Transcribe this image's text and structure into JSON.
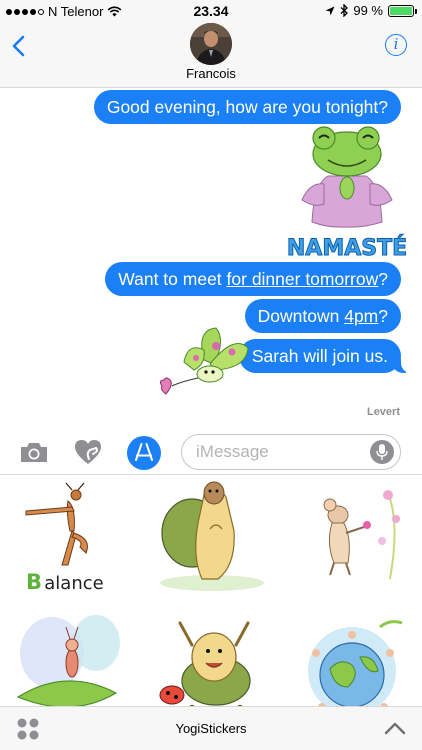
{
  "status_bar": {
    "carrier": "N Telenor",
    "time": "23.34",
    "battery_percent": "99 %",
    "battery_level": 0.99,
    "signal_bars_filled": 4,
    "signal_bars_total": 5
  },
  "header": {
    "contact_name": "Francois",
    "info_label": "i"
  },
  "messages": [
    {
      "type": "text",
      "text": "Good evening, how are you tonight?"
    },
    {
      "type": "sticker",
      "sticker_text": "NAMASTÉ",
      "icon": "frog-namaste-sticker"
    },
    {
      "type": "text",
      "parts": [
        "Want to meet ",
        "for dinner tomorrow",
        "?"
      ]
    },
    {
      "type": "text",
      "parts": [
        "Downtown ",
        "4pm",
        "?"
      ]
    },
    {
      "type": "text",
      "text": "Sarah will join us."
    },
    {
      "type": "sticker",
      "icon": "butterfly-heart-sticker"
    }
  ],
  "delivery_status": "Levert",
  "input_bar": {
    "placeholder": "iMessage",
    "value": "",
    "icons": [
      "camera-icon",
      "digital-touch-heart-icon",
      "app-store-icon",
      "microphone-icon"
    ]
  },
  "drawer": {
    "stickers": [
      {
        "name": "ant-balance-sticker",
        "caption": "Balance"
      },
      {
        "name": "turtle-yoga-sticker"
      },
      {
        "name": "mouse-flowers-sticker"
      },
      {
        "name": "fairy-leaf-sticker"
      },
      {
        "name": "turtle-ladybug-sticker"
      },
      {
        "name": "earth-yogis-sticker"
      }
    ]
  },
  "bottom_bar": {
    "app_name": "YogiStickers",
    "icons": [
      "app-drawer-grid-icon",
      "chevron-up-icon"
    ]
  },
  "colors": {
    "bubble_blue": "#1b7ff5",
    "link_blue": "#1a7cf5",
    "battery_green": "#4cd964",
    "bar_gray": "#f7f7f7"
  }
}
